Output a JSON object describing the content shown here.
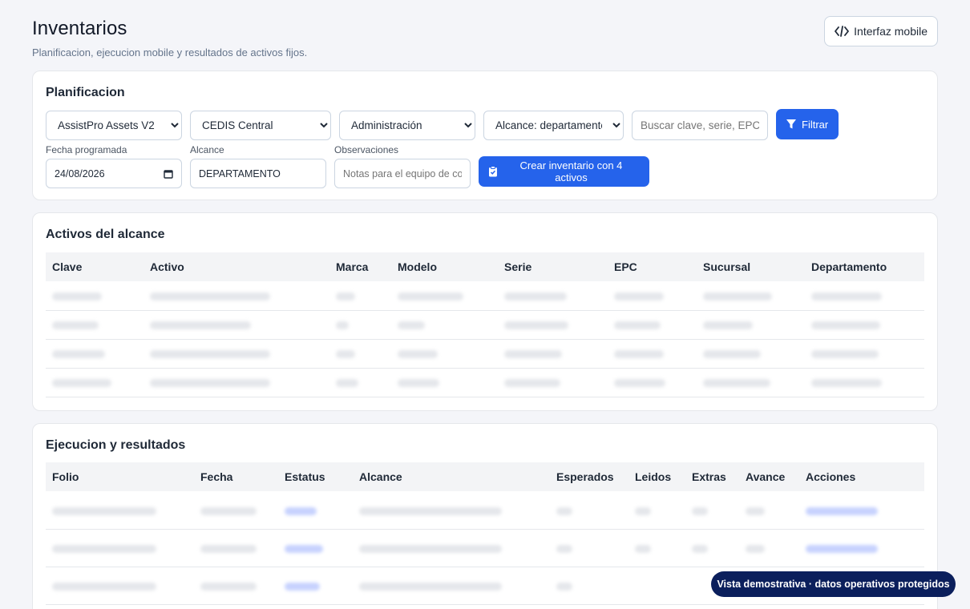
{
  "header": {
    "title": "Inventarios",
    "subtitle": "Planificacion, ejecucion mobile y resultados de activos fijos.",
    "mobile_button": "Interfaz mobile"
  },
  "planning": {
    "title": "Planificacion",
    "company_select": "AssistPro Assets V2",
    "branch_select": "CEDIS Central",
    "department_select": "Administración",
    "scope_select": "Alcance: departamento",
    "search_placeholder": "Buscar clave, serie, EPC o codigo",
    "filter_button": "Filtrar",
    "date_label": "Fecha programada",
    "date_value": "24/08/2026",
    "scope_label": "Alcance",
    "scope_value": "DEPARTAMENTO",
    "notes_label": "Observaciones",
    "notes_placeholder": "Notas para el equipo de conteo",
    "create_button": "Crear inventario con 4 activos"
  },
  "assets": {
    "title": "Activos del alcance",
    "columns": [
      "Clave",
      "Activo",
      "Marca",
      "Modelo",
      "Serie",
      "EPC",
      "Sucursal",
      "Departamento"
    ]
  },
  "execution": {
    "title": "Ejecucion y resultados",
    "columns": [
      "Folio",
      "Fecha",
      "Estatus",
      "Alcance",
      "Esperados",
      "Leidos",
      "Extras",
      "Avance",
      "Acciones"
    ]
  },
  "toast": "Vista demostrativa · datos operativos protegidos",
  "colors": {
    "primary": "#2563eb",
    "toast": "#0b1f5c"
  }
}
